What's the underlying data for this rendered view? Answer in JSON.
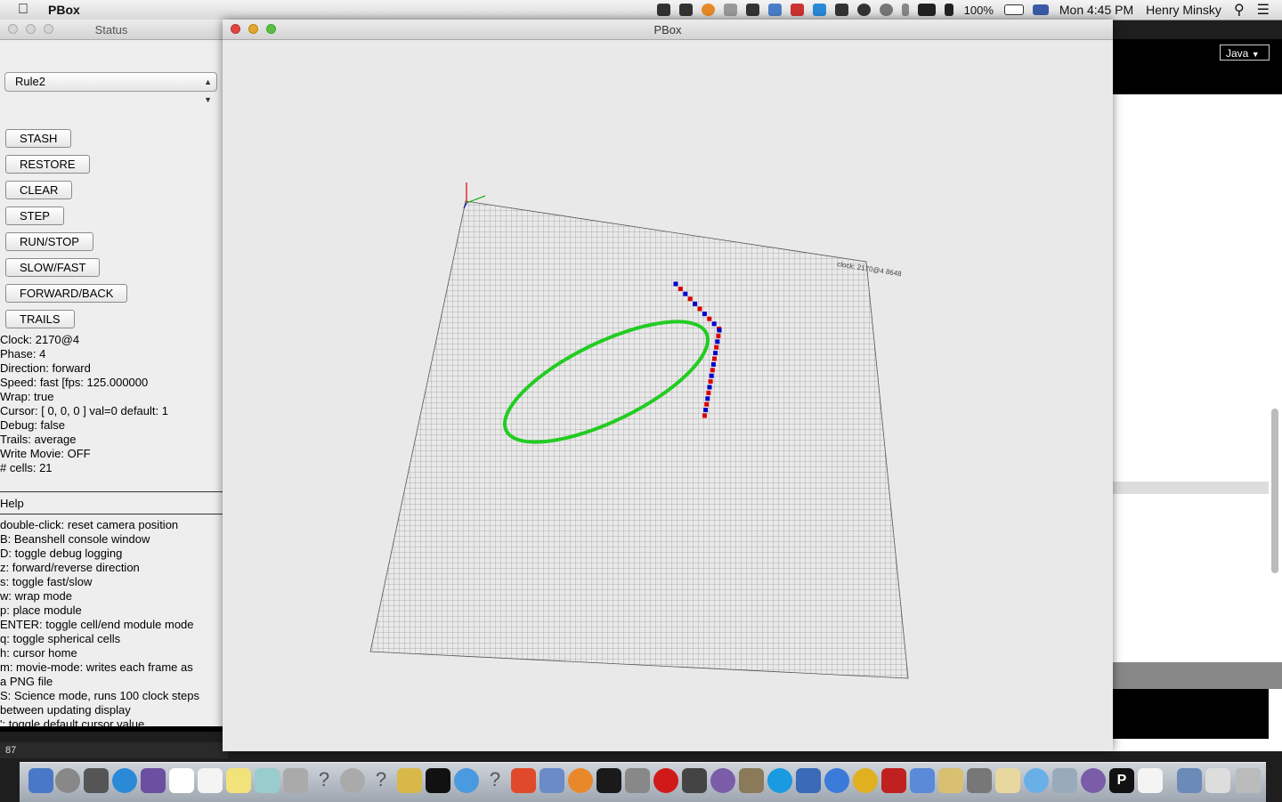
{
  "menubar": {
    "app_name": "PBox",
    "battery": "100%",
    "clock": "Mon 4:45 PM",
    "user": "Henry Minsky"
  },
  "status_window": {
    "title": "Status",
    "rule_select": "Rule2",
    "buttons": [
      "STASH",
      "RESTORE",
      "CLEAR",
      "STEP",
      "RUN/STOP",
      "SLOW/FAST",
      "FORWARD/BACK",
      "TRAILS"
    ],
    "info_lines": [
      "Clock: 2170@4",
      "Phase: 4",
      "Direction: forward",
      "Speed: fast [fps: 125.000000",
      "Wrap: true",
      "Cursor: [ 0, 0, 0 ]  val=0  default: 1",
      "Debug: false",
      "Trails: average",
      "Write Movie: OFF",
      "# cells: 21"
    ],
    "help_title": "Help",
    "help_lines": [
      "double-click: reset camera position",
      "B: Beanshell console window",
      "D: toggle debug logging",
      "z: forward/reverse direction",
      "s: toggle fast/slow",
      "w: wrap mode",
      "p: place module",
      "ENTER: toggle cell/end module mode",
      "q: toggle spherical cells",
      "h: cursor home",
      "m: movie-mode: writes each frame as",
      "a PNG file",
      "S: Science mode, runs 100 clock steps",
      "between updating display",
      "': toggle default cursor value"
    ]
  },
  "console_value": "87",
  "pbox_window": {
    "title": "PBox",
    "grid_label": "clock: 2170@4  8648"
  },
  "bg_app": {
    "language_select": "Java"
  },
  "colors": {
    "ring": "#22cc22",
    "cell_red": "#dd0000",
    "cell_blue": "#0000cc"
  }
}
